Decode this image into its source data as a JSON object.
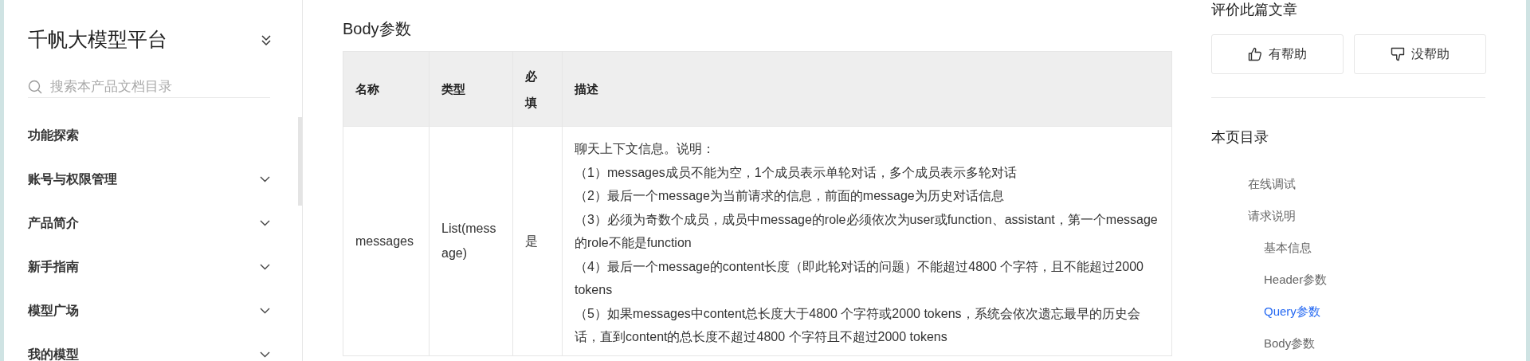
{
  "sidebar": {
    "title": "千帆大模型平台",
    "search": {
      "placeholder": "搜索本产品文档目录"
    },
    "items": [
      {
        "label": "功能探索",
        "expandable": false
      },
      {
        "label": "账号与权限管理",
        "expandable": true
      },
      {
        "label": "产品简介",
        "expandable": true
      },
      {
        "label": "新手指南",
        "expandable": true
      },
      {
        "label": "模型广场",
        "expandable": true
      },
      {
        "label": "我的模型",
        "expandable": true
      }
    ]
  },
  "main": {
    "heading": "Body参数",
    "table": {
      "columns": [
        "名称",
        "类型",
        "必填",
        "描述"
      ],
      "rows": [
        {
          "name": "messages",
          "type": "List(message)",
          "required": "是",
          "description": [
            "聊天上下文信息。说明：",
            "（1）messages成员不能为空，1个成员表示单轮对话，多个成员表示多轮对话",
            "（2）最后一个message为当前请求的信息，前面的message为历史对话信息",
            "（3）必须为奇数个成员，成员中message的role必须依次为user或function、assistant，第一个message的role不能是function",
            "（4）最后一个message的content长度（即此轮对话的问题）不能超过4800 个字符，且不能超过2000 tokens",
            "（5）如果messages中content总长度大于4800 个字符或2000 tokens，系统会依次遗忘最早的历史会话，直到content的总长度不超过4800 个字符且不超过2000 tokens"
          ]
        }
      ]
    }
  },
  "aside": {
    "rate_title": "评价此篇文章",
    "buttons": [
      {
        "label": "有帮助",
        "kind": "up"
      },
      {
        "label": "没帮助",
        "kind": "down"
      }
    ],
    "toc_title": "本页目录",
    "toc": [
      {
        "label": "在线调试",
        "selected": false
      },
      {
        "label": "请求说明",
        "selected": false,
        "children": [
          {
            "label": "基本信息",
            "selected": false
          },
          {
            "label": "Header参数",
            "selected": false
          },
          {
            "label": "Query参数",
            "selected": true
          },
          {
            "label": "Body参数",
            "selected": false
          }
        ]
      }
    ]
  }
}
